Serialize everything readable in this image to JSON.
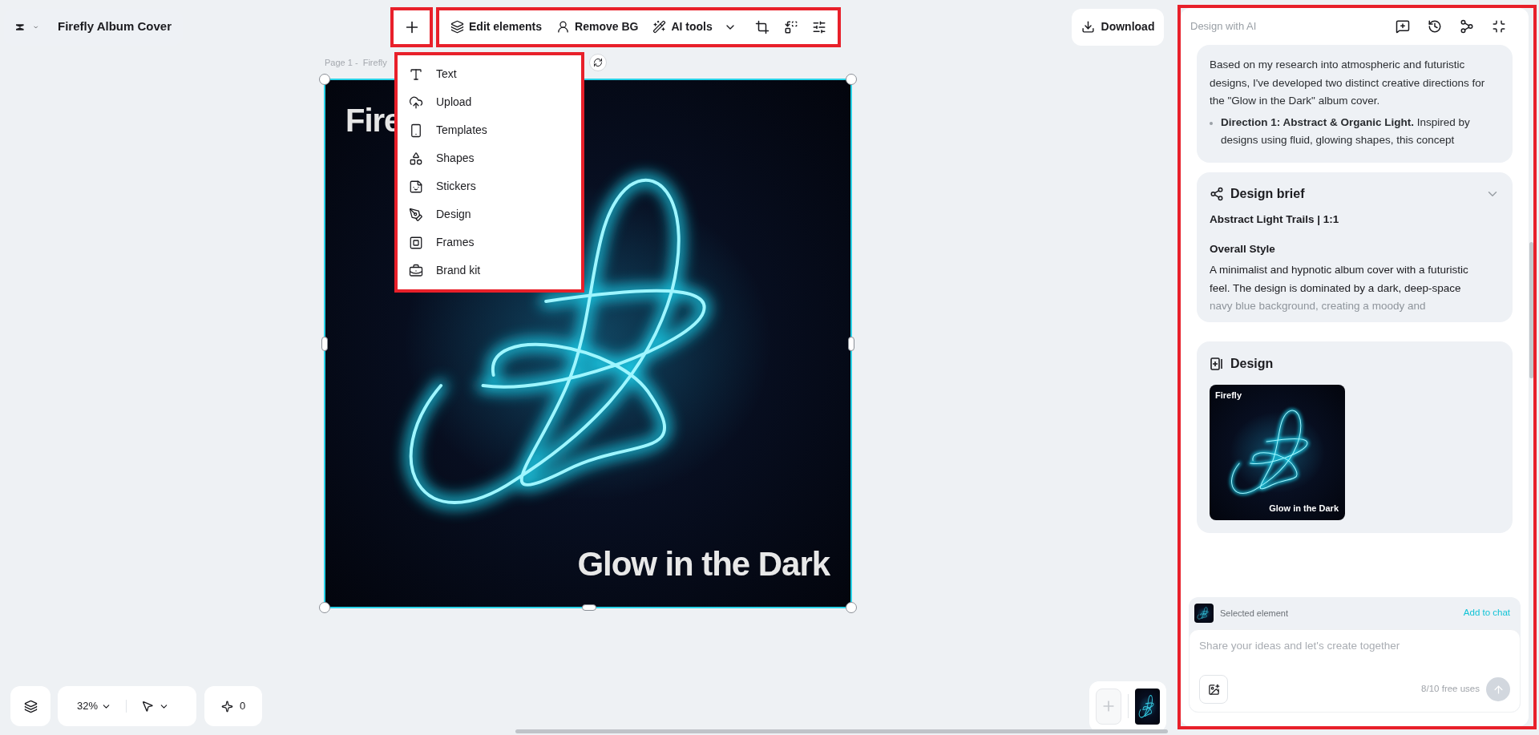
{
  "header": {
    "title": "Firefly Album Cover"
  },
  "toolbar": {
    "items": [
      {
        "kind": "button",
        "label": "Edit elements"
      },
      {
        "kind": "button",
        "label": "Remove BG"
      },
      {
        "kind": "dropdown",
        "label": "AI tools"
      }
    ]
  },
  "insert_menu": {
    "items": [
      {
        "label": "Text"
      },
      {
        "label": "Upload"
      },
      {
        "label": "Templates"
      },
      {
        "label": "Shapes"
      },
      {
        "label": "Stickers"
      },
      {
        "label": "Design"
      },
      {
        "label": "Frames"
      },
      {
        "label": "Brand kit"
      }
    ]
  },
  "download": {
    "label": "Download"
  },
  "canvas": {
    "page_label": "Page 1 -  Firefly",
    "title": "Fire",
    "subtitle": "Glow in the Dark"
  },
  "bottom_bar": {
    "zoom": "32%",
    "credits": "0"
  },
  "ai_panel": {
    "title": "Design with AI",
    "inspiration": {
      "paragraph": "Based on my research into atmospheric and futuristic designs, I've developed two distinct creative directions for the \"Glow in the Dark\" album cover.",
      "bullets": [
        "**Direction 1: Abstract & Organic Light.** Inspired by designs using fluid, glowing shapes, this concept"
      ]
    },
    "brief": {
      "title": "Design brief",
      "subtitle": "Abstract Light Trails | 1:1",
      "section": "Overall Style",
      "paragraph": "A minimalist and hypnotic album cover with a futuristic feel. The design is dominated by a dark, deep-space",
      "faded_line": "navy blue background, creating a moody and"
    },
    "design": {
      "title": "Design",
      "thumb_title": "Firefly",
      "thumb_subtitle": "Glow in the Dark"
    },
    "chat": {
      "selected_label": "Selected element",
      "add_link": "Add to chat",
      "placeholder": "Share your ideas and let's create together",
      "usage": "8/10 free uses"
    }
  }
}
